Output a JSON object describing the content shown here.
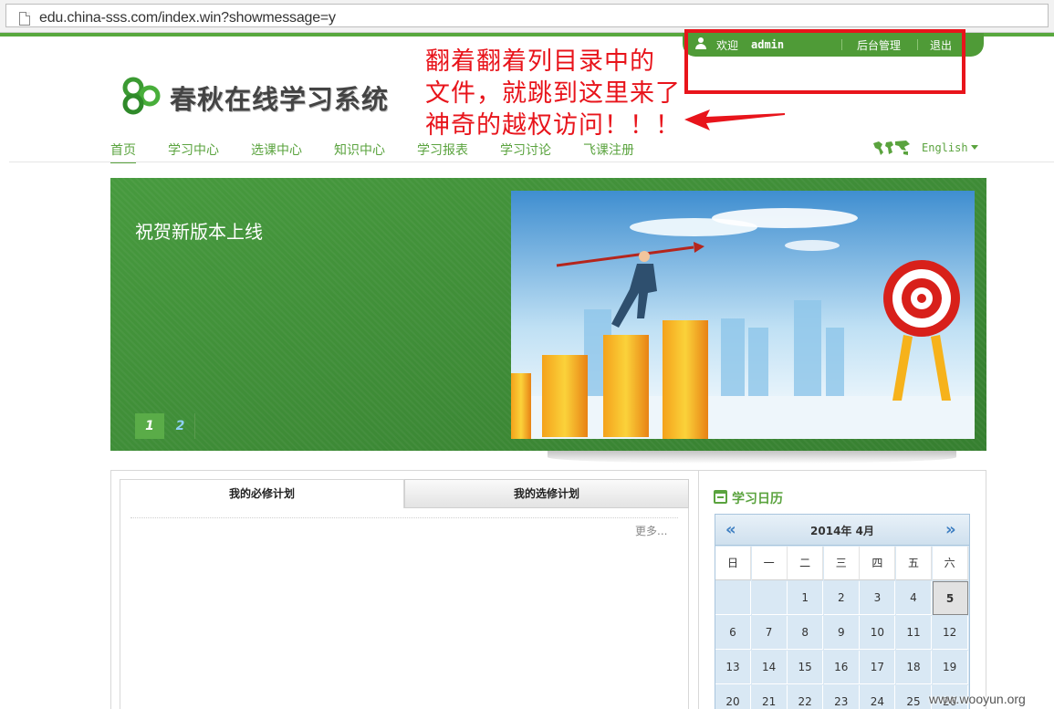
{
  "browser": {
    "url": "edu.china-sss.com/index.win?showmessage=y"
  },
  "userbar": {
    "welcome": "欢迎",
    "username": "admin",
    "backend": "后台管理",
    "logout": "退出"
  },
  "annotation": {
    "line1": "翻着翻着列目录中的",
    "line2": "文件，就跳到这里来了",
    "line3": "神奇的越权访问！！！",
    "color": "#e8141b"
  },
  "site": {
    "title": "春秋在线学习系统",
    "accent": "#5aa33e"
  },
  "nav": {
    "items": [
      "首页",
      "学习中心",
      "选课中心",
      "知识中心",
      "学习报表",
      "学习讨论",
      "飞课注册"
    ],
    "language": "English"
  },
  "banner": {
    "title": "祝贺新版本上线",
    "pages": [
      "1",
      "2"
    ]
  },
  "plans": {
    "tab_required": "我的必修计划",
    "tab_elective": "我的选修计划",
    "more": "更多..."
  },
  "calendar": {
    "title": "学习日历",
    "month": "2014年 4月",
    "weekdays": [
      "日",
      "一",
      "二",
      "三",
      "四",
      "五",
      "六"
    ],
    "weeks": [
      [
        "",
        "",
        "1",
        "2",
        "3",
        "4",
        "5"
      ],
      [
        "6",
        "7",
        "8",
        "9",
        "10",
        "11",
        "12"
      ],
      [
        "13",
        "14",
        "15",
        "16",
        "17",
        "18",
        "19"
      ],
      [
        "20",
        "21",
        "22",
        "23",
        "24",
        "25",
        "26"
      ]
    ],
    "today": "5"
  },
  "watermark": "www.wooyun.org"
}
